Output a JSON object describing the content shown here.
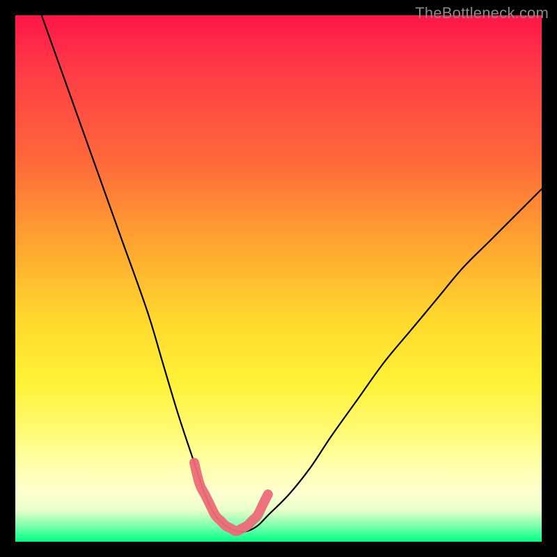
{
  "watermark": "TheBottleneck.com",
  "chart_data": {
    "type": "line",
    "title": "",
    "xlabel": "",
    "ylabel": "",
    "xlim": [
      0,
      100
    ],
    "ylim": [
      0,
      100
    ],
    "grid": false,
    "legend": false,
    "series": [
      {
        "name": "bottleneck-curve",
        "x": [
          5,
          10,
          15,
          20,
          25,
          28,
          31,
          34,
          36,
          38,
          40,
          42,
          44,
          46,
          48,
          52,
          56,
          60,
          65,
          70,
          75,
          80,
          85,
          90,
          95,
          100
        ],
        "values": [
          100,
          86,
          72,
          58,
          44,
          34,
          24,
          15,
          9,
          5,
          3,
          2,
          2,
          3,
          5,
          9,
          14,
          20,
          27,
          34,
          40,
          46,
          52,
          57,
          62,
          67
        ]
      }
    ],
    "highlight": {
      "name": "valley-marker",
      "x": [
        34,
        35,
        36,
        37,
        38,
        39,
        40,
        41,
        42,
        43,
        44,
        45,
        46,
        47,
        48
      ],
      "values": [
        15,
        11,
        9,
        7,
        5,
        4,
        3,
        2.5,
        2,
        2.5,
        3,
        4,
        5,
        7,
        9
      ],
      "color": "#ed6a78"
    },
    "gradient_stops": [
      {
        "pos": 0,
        "color": "#ff1549"
      },
      {
        "pos": 28,
        "color": "#ff6a3a"
      },
      {
        "pos": 58,
        "color": "#ffd92d"
      },
      {
        "pos": 85,
        "color": "#ffffa8"
      },
      {
        "pos": 97,
        "color": "#7dffae"
      },
      {
        "pos": 100,
        "color": "#00ff88"
      }
    ]
  }
}
